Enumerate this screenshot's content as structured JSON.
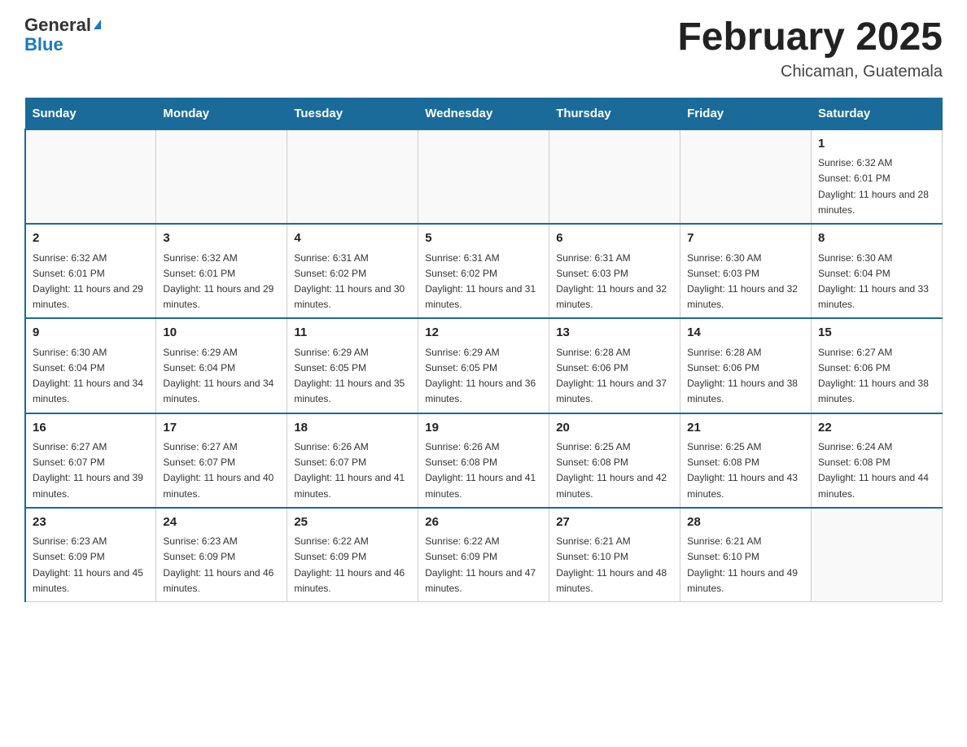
{
  "header": {
    "logo_general": "General",
    "logo_blue": "Blue",
    "month_title": "February 2025",
    "location": "Chicaman, Guatemala"
  },
  "days_of_week": [
    "Sunday",
    "Monday",
    "Tuesday",
    "Wednesday",
    "Thursday",
    "Friday",
    "Saturday"
  ],
  "weeks": [
    [
      {
        "day": "",
        "sunrise": "",
        "sunset": "",
        "daylight": ""
      },
      {
        "day": "",
        "sunrise": "",
        "sunset": "",
        "daylight": ""
      },
      {
        "day": "",
        "sunrise": "",
        "sunset": "",
        "daylight": ""
      },
      {
        "day": "",
        "sunrise": "",
        "sunset": "",
        "daylight": ""
      },
      {
        "day": "",
        "sunrise": "",
        "sunset": "",
        "daylight": ""
      },
      {
        "day": "",
        "sunrise": "",
        "sunset": "",
        "daylight": ""
      },
      {
        "day": "1",
        "sunrise": "Sunrise: 6:32 AM",
        "sunset": "Sunset: 6:01 PM",
        "daylight": "Daylight: 11 hours and 28 minutes."
      }
    ],
    [
      {
        "day": "2",
        "sunrise": "Sunrise: 6:32 AM",
        "sunset": "Sunset: 6:01 PM",
        "daylight": "Daylight: 11 hours and 29 minutes."
      },
      {
        "day": "3",
        "sunrise": "Sunrise: 6:32 AM",
        "sunset": "Sunset: 6:01 PM",
        "daylight": "Daylight: 11 hours and 29 minutes."
      },
      {
        "day": "4",
        "sunrise": "Sunrise: 6:31 AM",
        "sunset": "Sunset: 6:02 PM",
        "daylight": "Daylight: 11 hours and 30 minutes."
      },
      {
        "day": "5",
        "sunrise": "Sunrise: 6:31 AM",
        "sunset": "Sunset: 6:02 PM",
        "daylight": "Daylight: 11 hours and 31 minutes."
      },
      {
        "day": "6",
        "sunrise": "Sunrise: 6:31 AM",
        "sunset": "Sunset: 6:03 PM",
        "daylight": "Daylight: 11 hours and 32 minutes."
      },
      {
        "day": "7",
        "sunrise": "Sunrise: 6:30 AM",
        "sunset": "Sunset: 6:03 PM",
        "daylight": "Daylight: 11 hours and 32 minutes."
      },
      {
        "day": "8",
        "sunrise": "Sunrise: 6:30 AM",
        "sunset": "Sunset: 6:04 PM",
        "daylight": "Daylight: 11 hours and 33 minutes."
      }
    ],
    [
      {
        "day": "9",
        "sunrise": "Sunrise: 6:30 AM",
        "sunset": "Sunset: 6:04 PM",
        "daylight": "Daylight: 11 hours and 34 minutes."
      },
      {
        "day": "10",
        "sunrise": "Sunrise: 6:29 AM",
        "sunset": "Sunset: 6:04 PM",
        "daylight": "Daylight: 11 hours and 34 minutes."
      },
      {
        "day": "11",
        "sunrise": "Sunrise: 6:29 AM",
        "sunset": "Sunset: 6:05 PM",
        "daylight": "Daylight: 11 hours and 35 minutes."
      },
      {
        "day": "12",
        "sunrise": "Sunrise: 6:29 AM",
        "sunset": "Sunset: 6:05 PM",
        "daylight": "Daylight: 11 hours and 36 minutes."
      },
      {
        "day": "13",
        "sunrise": "Sunrise: 6:28 AM",
        "sunset": "Sunset: 6:06 PM",
        "daylight": "Daylight: 11 hours and 37 minutes."
      },
      {
        "day": "14",
        "sunrise": "Sunrise: 6:28 AM",
        "sunset": "Sunset: 6:06 PM",
        "daylight": "Daylight: 11 hours and 38 minutes."
      },
      {
        "day": "15",
        "sunrise": "Sunrise: 6:27 AM",
        "sunset": "Sunset: 6:06 PM",
        "daylight": "Daylight: 11 hours and 38 minutes."
      }
    ],
    [
      {
        "day": "16",
        "sunrise": "Sunrise: 6:27 AM",
        "sunset": "Sunset: 6:07 PM",
        "daylight": "Daylight: 11 hours and 39 minutes."
      },
      {
        "day": "17",
        "sunrise": "Sunrise: 6:27 AM",
        "sunset": "Sunset: 6:07 PM",
        "daylight": "Daylight: 11 hours and 40 minutes."
      },
      {
        "day": "18",
        "sunrise": "Sunrise: 6:26 AM",
        "sunset": "Sunset: 6:07 PM",
        "daylight": "Daylight: 11 hours and 41 minutes."
      },
      {
        "day": "19",
        "sunrise": "Sunrise: 6:26 AM",
        "sunset": "Sunset: 6:08 PM",
        "daylight": "Daylight: 11 hours and 41 minutes."
      },
      {
        "day": "20",
        "sunrise": "Sunrise: 6:25 AM",
        "sunset": "Sunset: 6:08 PM",
        "daylight": "Daylight: 11 hours and 42 minutes."
      },
      {
        "day": "21",
        "sunrise": "Sunrise: 6:25 AM",
        "sunset": "Sunset: 6:08 PM",
        "daylight": "Daylight: 11 hours and 43 minutes."
      },
      {
        "day": "22",
        "sunrise": "Sunrise: 6:24 AM",
        "sunset": "Sunset: 6:08 PM",
        "daylight": "Daylight: 11 hours and 44 minutes."
      }
    ],
    [
      {
        "day": "23",
        "sunrise": "Sunrise: 6:23 AM",
        "sunset": "Sunset: 6:09 PM",
        "daylight": "Daylight: 11 hours and 45 minutes."
      },
      {
        "day": "24",
        "sunrise": "Sunrise: 6:23 AM",
        "sunset": "Sunset: 6:09 PM",
        "daylight": "Daylight: 11 hours and 46 minutes."
      },
      {
        "day": "25",
        "sunrise": "Sunrise: 6:22 AM",
        "sunset": "Sunset: 6:09 PM",
        "daylight": "Daylight: 11 hours and 46 minutes."
      },
      {
        "day": "26",
        "sunrise": "Sunrise: 6:22 AM",
        "sunset": "Sunset: 6:09 PM",
        "daylight": "Daylight: 11 hours and 47 minutes."
      },
      {
        "day": "27",
        "sunrise": "Sunrise: 6:21 AM",
        "sunset": "Sunset: 6:10 PM",
        "daylight": "Daylight: 11 hours and 48 minutes."
      },
      {
        "day": "28",
        "sunrise": "Sunrise: 6:21 AM",
        "sunset": "Sunset: 6:10 PM",
        "daylight": "Daylight: 11 hours and 49 minutes."
      },
      {
        "day": "",
        "sunrise": "",
        "sunset": "",
        "daylight": ""
      }
    ]
  ]
}
